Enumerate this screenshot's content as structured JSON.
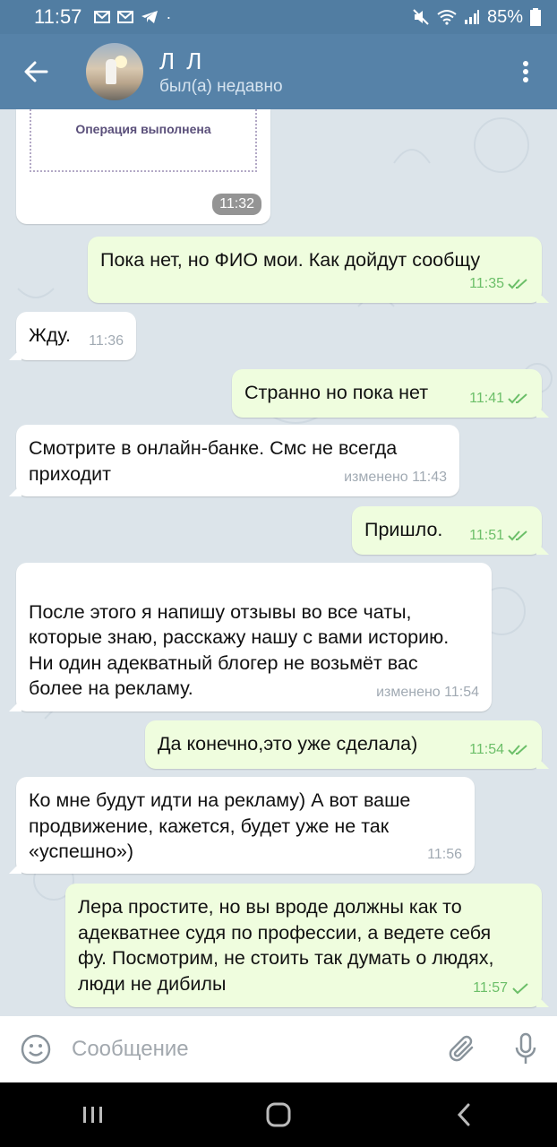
{
  "status_bar": {
    "time": "11:57",
    "battery": "85%",
    "dot": "·"
  },
  "header": {
    "title": "Л Л",
    "status": "был(а) недавно"
  },
  "image_message": {
    "receipt_text": "Операция выполнена",
    "time": "11:32"
  },
  "messages": [
    {
      "dir": "out",
      "text": "Пока нет, но ФИО мои. Как дойдут сообщу",
      "time": "11:35",
      "checks": "double"
    },
    {
      "dir": "in",
      "text": "Жду.",
      "time": "11:36"
    },
    {
      "dir": "out",
      "text": "Странно но пока нет",
      "time": "11:41",
      "checks": "double"
    },
    {
      "dir": "in",
      "text": "Смотрите в онлайн-банке. Смс не всегда приходит",
      "time": "изменено 11:43"
    },
    {
      "dir": "out",
      "text": "Пришло.",
      "time": "11:51",
      "checks": "double"
    },
    {
      "dir": "in",
      "text": "После этого я напишу отзывы во все чаты, которые знаю, расскажу нашу с вами историю.\nНи один адекватный блогер не возьмёт вас более на рекламу.",
      "time": "изменено 11:54"
    },
    {
      "dir": "out",
      "text": "Да конечно,это уже сделала)",
      "time": "11:54",
      "checks": "double"
    },
    {
      "dir": "in",
      "text": "Ко мне будут идти на рекламу) А вот ваше продвижение, кажется, будет уже не так «успешно»)",
      "time": "11:56"
    },
    {
      "dir": "out",
      "text": "Лера простите, но вы вроде должны как то адекватнее судя по профессии, а ведете себя фу. Посмотрим, не стоить так думать о людях, люди не дибилы",
      "time": "11:57",
      "checks": "single"
    }
  ],
  "input": {
    "placeholder": "Сообщение"
  },
  "colors": {
    "header": "#5682a8",
    "outgoing": "#effdde",
    "incoming": "#ffffff",
    "check": "#6cbf69"
  },
  "icons": [
    "back-arrow-icon",
    "more-vert-icon",
    "emoji-icon",
    "attach-icon",
    "mic-icon",
    "recent-apps-icon",
    "home-icon",
    "back-nav-icon"
  ]
}
